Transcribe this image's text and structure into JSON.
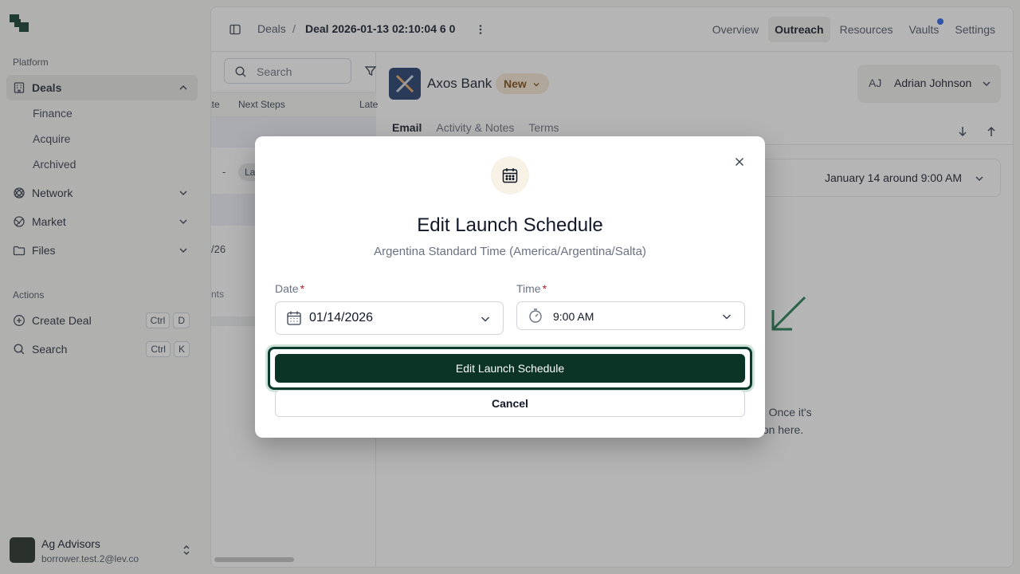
{
  "sidebar": {
    "platform_label": "Platform",
    "deals_label": "Deals",
    "sub_items": [
      "Finance",
      "Acquire",
      "Archived"
    ],
    "network_label": "Network",
    "market_label": "Market",
    "files_label": "Files",
    "actions_label": "Actions",
    "create_deal_label": "Create Deal",
    "create_deal_keys": [
      "Ctrl",
      "D"
    ],
    "search_label": "Search",
    "search_keys": [
      "Ctrl",
      "K"
    ],
    "account": {
      "name": "Ag Advisors",
      "email": "borrower.test.2@lev.co"
    }
  },
  "header": {
    "breadcrumb_root": "Deals",
    "breadcrumb_sep": "/",
    "breadcrumb_current": "Deal 2026-01-13 02:10:04 6 0",
    "tabs": [
      "Overview",
      "Outreach",
      "Resources",
      "Vaults",
      "Settings"
    ],
    "active_tab": "Outreach"
  },
  "list": {
    "search_placeholder": "Search",
    "columns": [
      "ate",
      "Next Steps",
      "Late"
    ],
    "row_dash": "-",
    "row_pill": "La",
    "row_date_frag": "/26",
    "row_text_frag": "nts"
  },
  "content": {
    "bank_name": "Axos Bank",
    "status": "New",
    "owner_initials": "AJ",
    "owner_name": "Adrian Johnson",
    "tabs": [
      "Email",
      "Activity & Notes",
      "Terms"
    ],
    "schedule_text": "January 14 around 9:00 AM",
    "hint_line1": "ch. Once it's",
    "hint_line2": "ation here."
  },
  "modal": {
    "title": "Edit Launch Schedule",
    "subtitle": "Argentina Standard Time (America/Argentina/Salta)",
    "date_label": "Date",
    "date_value": "01/14/2026",
    "time_label": "Time",
    "time_value": "9:00 AM",
    "required_mark": "*",
    "primary_button": "Edit Launch Schedule",
    "cancel_button": "Cancel"
  },
  "colors": {
    "brand": "#0b3326",
    "status_bg": "#f7e9d4",
    "notification_dot": "#2563eb"
  }
}
